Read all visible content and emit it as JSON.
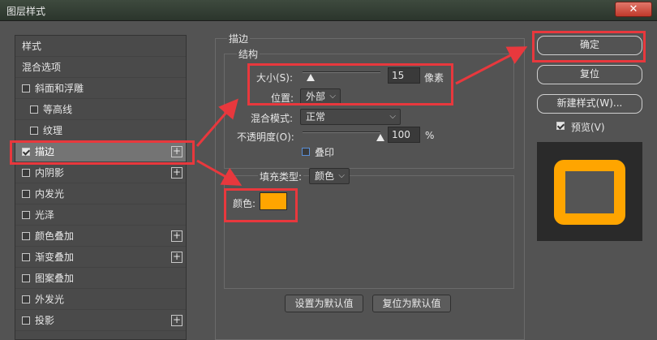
{
  "window": {
    "title": "图层样式",
    "close_glyph": "✕"
  },
  "style_list": {
    "items": [
      {
        "label": "样式",
        "checkbox": false,
        "plus": false,
        "indent": false,
        "selected": false
      },
      {
        "label": "混合选项",
        "checkbox": false,
        "plus": false,
        "indent": false,
        "selected": false
      },
      {
        "label": "斜面和浮雕",
        "checkbox": true,
        "checked": false,
        "plus": false,
        "indent": false,
        "selected": false
      },
      {
        "label": "等高线",
        "checkbox": true,
        "checked": false,
        "plus": false,
        "indent": true,
        "selected": false
      },
      {
        "label": "纹理",
        "checkbox": true,
        "checked": false,
        "plus": false,
        "indent": true,
        "selected": false
      },
      {
        "label": "描边",
        "checkbox": true,
        "checked": true,
        "plus": true,
        "indent": false,
        "selected": true
      },
      {
        "label": "内阴影",
        "checkbox": true,
        "checked": false,
        "plus": true,
        "indent": false,
        "selected": false
      },
      {
        "label": "内发光",
        "checkbox": true,
        "checked": false,
        "plus": false,
        "indent": false,
        "selected": false
      },
      {
        "label": "光泽",
        "checkbox": true,
        "checked": false,
        "plus": false,
        "indent": false,
        "selected": false
      },
      {
        "label": "颜色叠加",
        "checkbox": true,
        "checked": false,
        "plus": true,
        "indent": false,
        "selected": false
      },
      {
        "label": "渐变叠加",
        "checkbox": true,
        "checked": false,
        "plus": true,
        "indent": false,
        "selected": false
      },
      {
        "label": "图案叠加",
        "checkbox": true,
        "checked": false,
        "plus": false,
        "indent": false,
        "selected": false
      },
      {
        "label": "外发光",
        "checkbox": true,
        "checked": false,
        "plus": false,
        "indent": false,
        "selected": false
      },
      {
        "label": "投影",
        "checkbox": true,
        "checked": false,
        "plus": true,
        "indent": false,
        "selected": false
      }
    ],
    "plus_glyph": "+"
  },
  "stroke": {
    "section_title": "描边",
    "structure_title": "结构",
    "size_label": "大小(S):",
    "size_value": "15",
    "size_unit": "像素",
    "size_fraction": 0.1,
    "position_label": "位置:",
    "position_value": "外部",
    "blend_label": "混合模式:",
    "blend_value": "正常",
    "opacity_label": "不透明度(O):",
    "opacity_value": "100",
    "opacity_unit": "%",
    "opacity_fraction": 1.0,
    "overprint_label": "叠印",
    "fill_type_label": "填充类型:",
    "fill_type_value": "颜色",
    "color_label": "颜色:",
    "color_value": "#ffa500",
    "set_default_button": "设置为默认值",
    "reset_default_button": "复位为默认值"
  },
  "actions": {
    "ok_button": "确定",
    "reset_button": "复位",
    "new_style_button": "新建样式(W)...",
    "preview_label": "预览(V)",
    "preview_checked": true
  },
  "colors": {
    "accent": "#ffa500",
    "annotation": "#e8383d"
  }
}
